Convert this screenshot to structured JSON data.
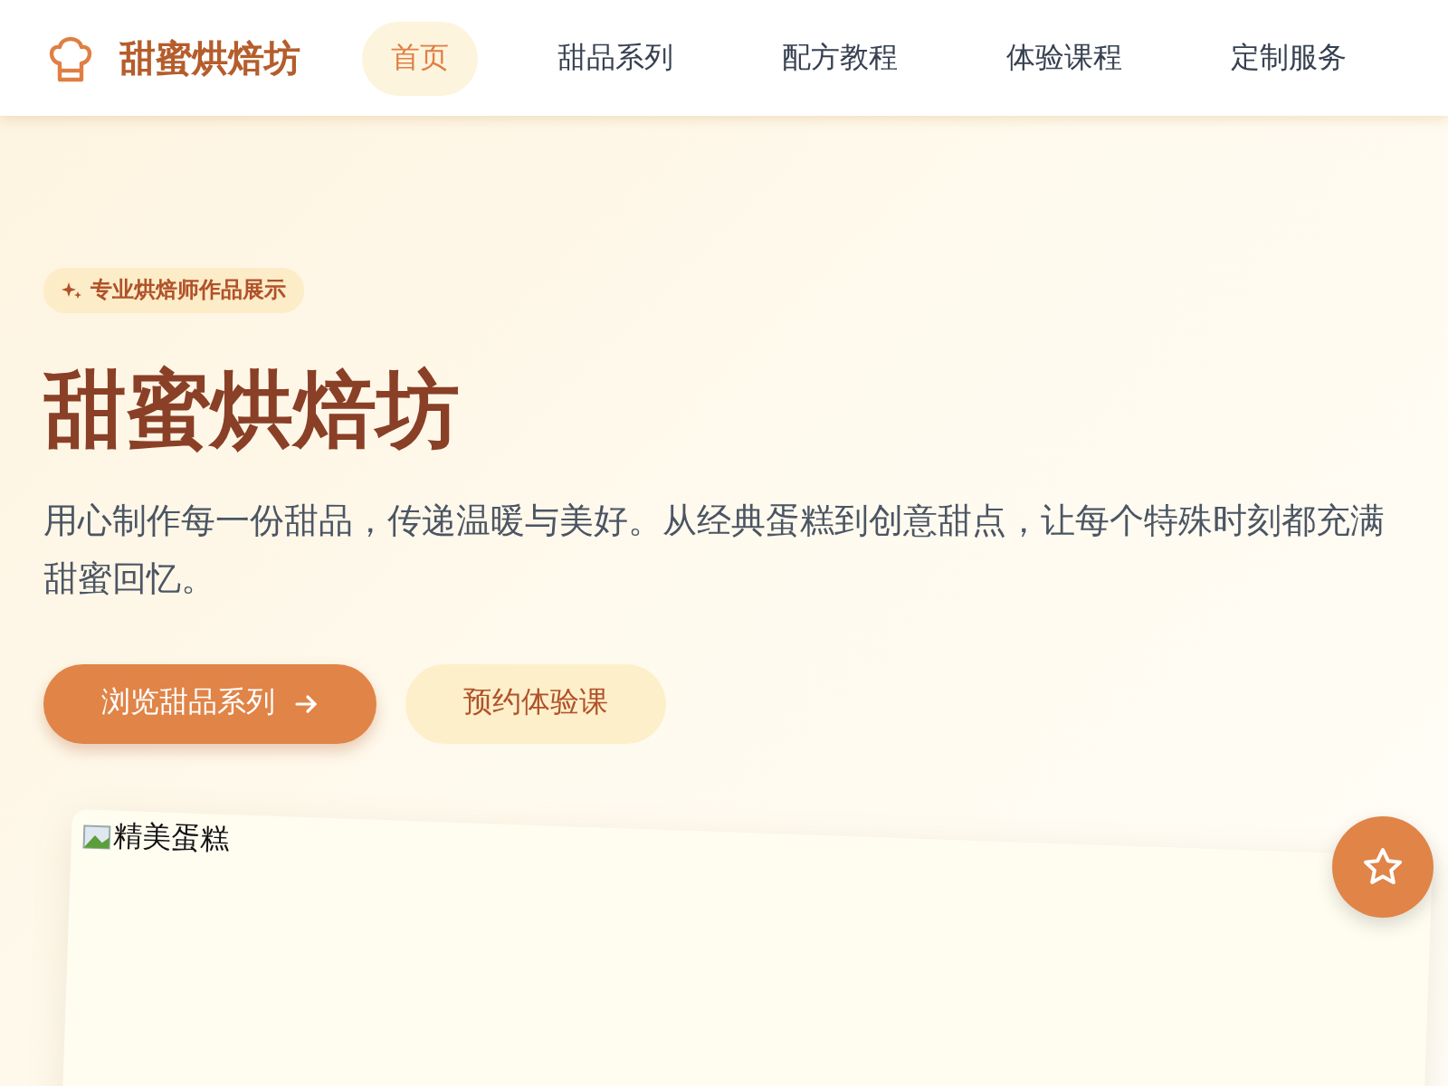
{
  "brand": {
    "name": "甜蜜烘焙坊"
  },
  "nav": [
    {
      "label": "首页",
      "selected": true
    },
    {
      "label": "甜品系列",
      "selected": false
    },
    {
      "label": "配方教程",
      "selected": false
    },
    {
      "label": "体验课程",
      "selected": false
    },
    {
      "label": "定制服务",
      "selected": false
    }
  ],
  "hero": {
    "badge": "专业烘焙师作品展示",
    "title": "甜蜜烘焙坊",
    "description": "用心制作每一份甜品，传递温暖与美好。从经典蛋糕到创意甜点，让每个特殊时刻都充满甜蜜回忆。",
    "buttons": [
      {
        "label": "浏览甜品系列",
        "kind": "primary"
      },
      {
        "label": "预约体验课",
        "kind": "secondary"
      }
    ],
    "image": {
      "alt": "精美蛋糕"
    }
  }
}
